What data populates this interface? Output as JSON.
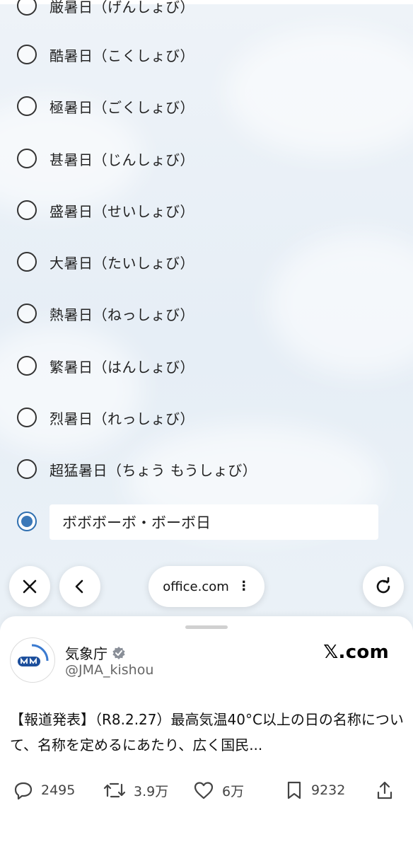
{
  "survey": {
    "partial_top_label": "厳暑日（げんしょび）",
    "options": [
      {
        "label": "酷暑日（こくしょび）",
        "selected": false
      },
      {
        "label": "極暑日（ごくしょび）",
        "selected": false
      },
      {
        "label": "甚暑日（じんしょび）",
        "selected": false
      },
      {
        "label": "盛暑日（せいしょび）",
        "selected": false
      },
      {
        "label": "大暑日（たいしょび）",
        "selected": false
      },
      {
        "label": "熱暑日（ねっしょび）",
        "selected": false
      },
      {
        "label": "繁暑日（はんしょび）",
        "selected": false
      },
      {
        "label": "烈暑日（れっしょび）",
        "selected": false
      },
      {
        "label": "超猛暑日（ちょう もうしょび）",
        "selected": false
      }
    ],
    "other_option": {
      "selected": true,
      "value": "ボボボーボ・ボーボ日"
    }
  },
  "browser_bar": {
    "close_icon": "close-icon",
    "back_icon": "chevron-left-icon",
    "url": "office.com",
    "menu_icon": "more-vertical-icon",
    "reload_icon": "reload-icon"
  },
  "post": {
    "account_name": "気象庁",
    "account_handle": "@JMA_kishou",
    "site": "𝕏.com",
    "text": "【報道発表】（R8.2.27）最高気温40°C以上の日の名称について、名称を定めるにあたり、広く国民...",
    "stats": {
      "replies": "2495",
      "reposts": "3.9万",
      "likes": "6万",
      "bookmarks": "9232"
    }
  },
  "colors": {
    "radio_selected": "#3b78b8",
    "verified_badge": "#8a8f98"
  }
}
